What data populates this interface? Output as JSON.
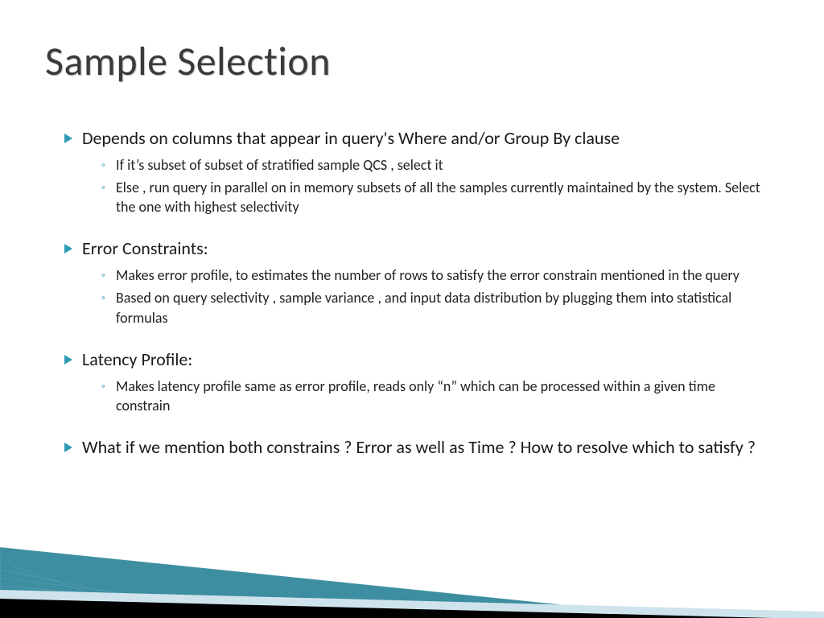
{
  "title": "Sample Selection",
  "accent": "#2f9bb3",
  "bullets": [
    {
      "text": "Depends on columns that appear in query's Where and/or Group By clause",
      "sub": [
        "If it’s subset of subset of stratified sample QCS , select it",
        "Else , run query in parallel on in memory subsets of  all the samples currently maintained by the system. Select the one with highest selectivity"
      ]
    },
    {
      "text": "Error Constraints:",
      "sub": [
        "Makes error profile, to estimates the number of rows to satisfy the   error constrain mentioned in the query",
        "Based on query selectivity , sample variance , and input data distribution by plugging them into statistical formulas"
      ]
    },
    {
      "text": "Latency Profile:",
      "sub": [
        "Makes latency profile same as error profile, reads  only “n” which can be processed within a given time constrain"
      ]
    },
    {
      "text": "What if we mention both constrains ? Error as well as Time ? How to resolve which to satisfy ?",
      "sub": []
    }
  ]
}
